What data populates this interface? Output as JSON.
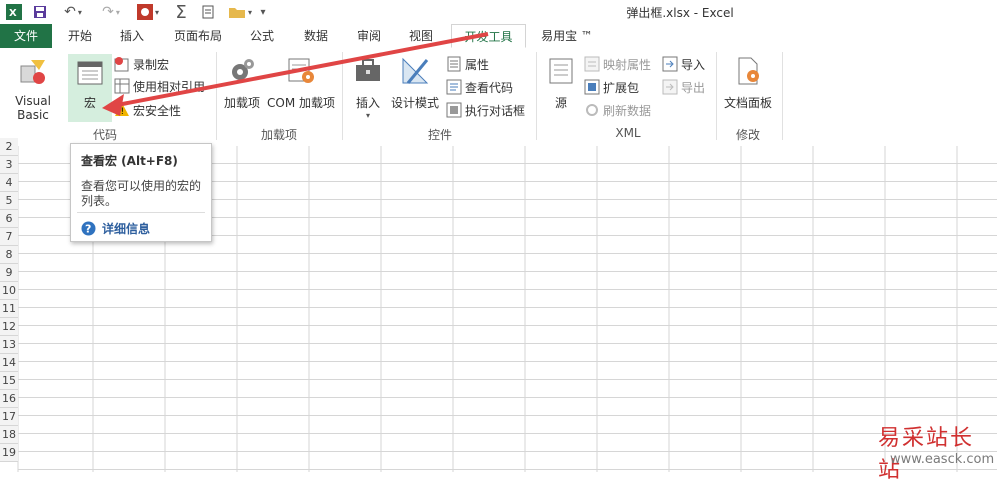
{
  "window": {
    "title": "弹出框.xlsx - Excel"
  },
  "tabs": [
    {
      "label": "文件"
    },
    {
      "label": "开始"
    },
    {
      "label": "插入"
    },
    {
      "label": "页面布局"
    },
    {
      "label": "公式"
    },
    {
      "label": "数据"
    },
    {
      "label": "审阅"
    },
    {
      "label": "视图"
    },
    {
      "label": "开发工具"
    },
    {
      "label": "易用宝 ™"
    }
  ],
  "ribbon": {
    "code": {
      "group_label": "代码",
      "visual_basic": "Visual Basic",
      "macros": "宏",
      "record_macro": "录制宏",
      "relative_ref": "使用相对引用",
      "macro_security": "宏安全性"
    },
    "addins": {
      "group_label": "加载项",
      "addins": "加载项",
      "com_addins": "COM 加载项"
    },
    "controls": {
      "group_label": "控件",
      "insert": "插入",
      "design_mode": "设计模式",
      "properties": "属性",
      "view_code": "查看代码",
      "run_dialog": "执行对话框"
    },
    "xml": {
      "group_label": "XML",
      "source": "源",
      "map_props": "映射属性",
      "expansion": "扩展包",
      "refresh": "刷新数据",
      "import": "导入",
      "export": "导出"
    },
    "modify": {
      "group_label": "修改",
      "doc_panel": "文档面板"
    }
  },
  "rows": [
    "2",
    "3",
    "4",
    "5",
    "6",
    "7",
    "8",
    "9",
    "10",
    "11",
    "12",
    "13",
    "14",
    "15",
    "16",
    "17",
    "18",
    "19"
  ],
  "tooltip": {
    "title": "查看宏 (Alt+F8)",
    "line1": "查看您可以使用的宏的",
    "line2": "列表。",
    "link": "详细信息"
  },
  "watermark": {
    "name": "易采站长站",
    "url": "www.easck.com"
  },
  "colors": {
    "excel_green": "#217346",
    "arrow_red": "#e04545",
    "grid_line": "#d6d6d6"
  }
}
